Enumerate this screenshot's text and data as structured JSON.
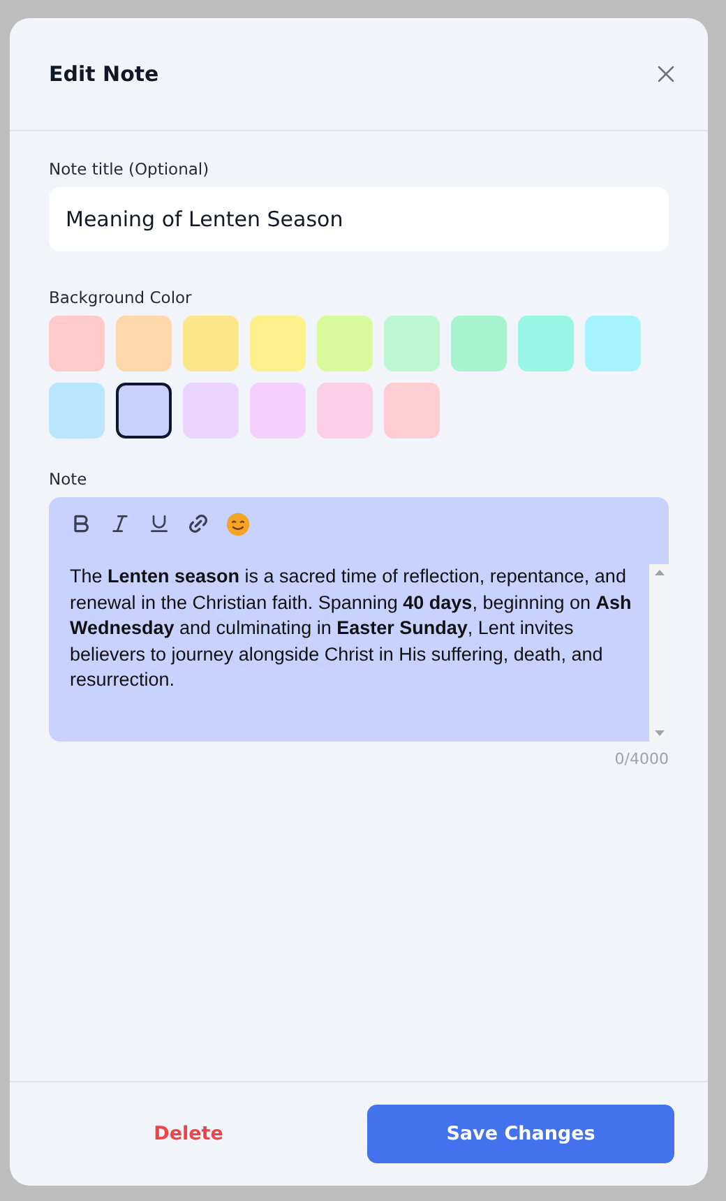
{
  "dialog": {
    "title": "Edit Note"
  },
  "title_field": {
    "label": "Note title (Optional)",
    "value": "Meaning of Lenten Season"
  },
  "background_color": {
    "label": "Background Color",
    "swatches": [
      {
        "color": "#fecaca",
        "selected": false
      },
      {
        "color": "#fed7aa",
        "selected": false
      },
      {
        "color": "#fde68a",
        "selected": false
      },
      {
        "color": "#fef08a",
        "selected": false
      },
      {
        "color": "#d9f99d",
        "selected": false
      },
      {
        "color": "#bbf7d0",
        "selected": false
      },
      {
        "color": "#a7f3d0",
        "selected": false
      },
      {
        "color": "#99f6e4",
        "selected": false
      },
      {
        "color": "#a5f3fc",
        "selected": false
      },
      {
        "color": "#bae6fd",
        "selected": false
      },
      {
        "color": "#c7d2fe",
        "selected": true
      },
      {
        "color": "#e9d5ff",
        "selected": false
      },
      {
        "color": "#f5d0fe",
        "selected": false
      },
      {
        "color": "#fbcfe8",
        "selected": false
      },
      {
        "color": "#fecdd3",
        "selected": false
      }
    ]
  },
  "note": {
    "label": "Note",
    "text": "The **Lenten season** is a sacred time of reflection, repentance, and renewal in the Christian faith. Spanning **40 days**, beginning on **Ash Wednesday** and culminating in **Easter Sunday**, Lent invites believers to journey alongside Christ in His suffering, death, and resurrection.",
    "counter": "0/4000"
  },
  "footer": {
    "delete": "Delete",
    "save": "Save Changes"
  }
}
